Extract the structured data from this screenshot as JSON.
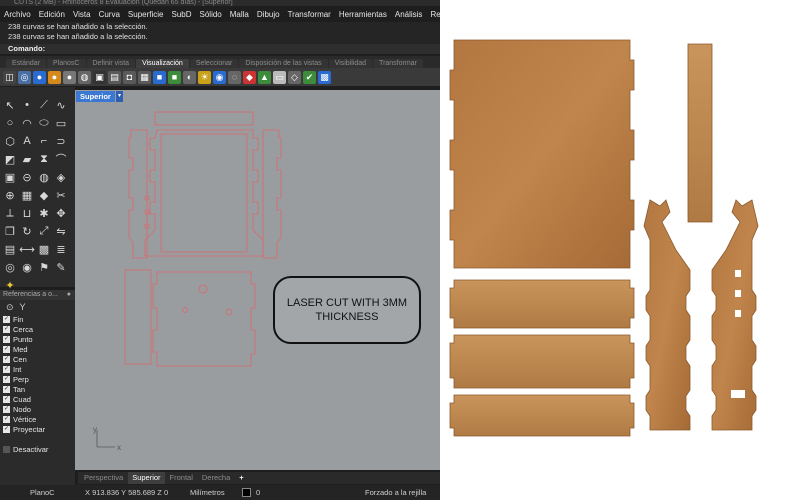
{
  "window": {
    "title": "CUTS (2 MB) - Rhinoceros 8 Evaluación (Quedan 65 días) - [Superior]"
  },
  "menu": [
    "Archivo",
    "Edición",
    "Vista",
    "Curva",
    "Superficie",
    "SubD",
    "Sólido",
    "Malla",
    "Dibujo",
    "Transformar",
    "Herramientas",
    "Análisis",
    "Render"
  ],
  "command_history": [
    "238 curvas se han añadido a la selección.",
    "238 curvas se han añadido a la selección."
  ],
  "command_prompt": "Comando:",
  "toolbar_tabs": [
    "Estándar",
    "PlanosC",
    "Definir vista",
    "Visualización",
    "Seleccionar",
    "Disposición de las vistas",
    "Visibilidad",
    "Transformar"
  ],
  "active_toolbar_tab": "Visualización",
  "viewport": {
    "title": "Superior",
    "dropdown_glyph": "▾"
  },
  "annotation": {
    "line1": "LASER CUT WITH 3MM",
    "line2": "THICKNESS"
  },
  "osnap": {
    "header": "Referencias a o...",
    "items": [
      {
        "label": "Fin",
        "checked": true
      },
      {
        "label": "Cerca",
        "checked": true
      },
      {
        "label": "Punto",
        "checked": true
      },
      {
        "label": "Med",
        "checked": true
      },
      {
        "label": "Cen",
        "checked": true
      },
      {
        "label": "Int",
        "checked": true
      },
      {
        "label": "Perp",
        "checked": true
      },
      {
        "label": "Tan",
        "checked": true
      },
      {
        "label": "Cuad",
        "checked": true
      },
      {
        "label": "Nodo",
        "checked": true
      },
      {
        "label": "Vértice",
        "checked": true
      },
      {
        "label": "Proyectar",
        "checked": true
      }
    ],
    "disable_label": "Desactivar"
  },
  "viewport_tabs": [
    "Perspectiva",
    "Superior",
    "Frontal",
    "Derecha",
    "+"
  ],
  "active_viewport_tab": "Superior",
  "status": {
    "cplane": "PlanoC",
    "coords": "X 913.836 Y 585.689 Z 0",
    "units": "Milímetros",
    "layer": "0",
    "grid_snap": "Forzado a la rejilla"
  },
  "axes": {
    "x": "x",
    "y": "y"
  },
  "colors": {
    "cut_lines": "#d9686c",
    "viewport_bg": "#9a9da0",
    "accent": "#3a78d4",
    "wood": "#b77a3f"
  }
}
